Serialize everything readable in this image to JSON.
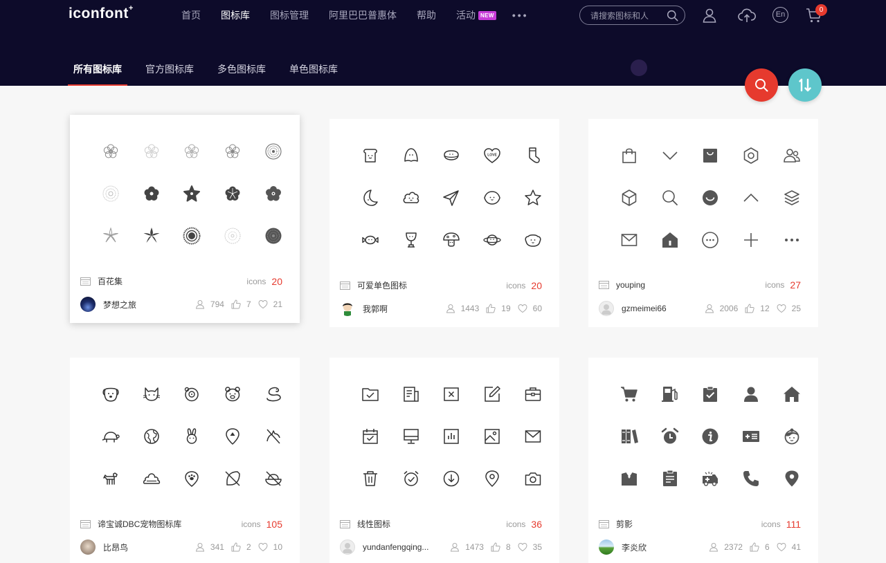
{
  "header": {
    "logo": "iconfont",
    "logo_mark": "+",
    "nav": [
      {
        "label": "首页",
        "active": false
      },
      {
        "label": "图标库",
        "active": true
      },
      {
        "label": "图标管理",
        "active": false
      },
      {
        "label": "阿里巴巴普惠体",
        "active": false
      },
      {
        "label": "帮助",
        "active": false
      },
      {
        "label": "活动",
        "active": false,
        "badge": "NEW"
      }
    ],
    "more": "•••",
    "search_placeholder": "请搜索图标和人",
    "lang": "En",
    "cart_count": "0",
    "subtabs": [
      {
        "label": "所有图标库",
        "active": true
      },
      {
        "label": "官方图标库",
        "active": false
      },
      {
        "label": "多色图标库",
        "active": false
      },
      {
        "label": "单色图标库",
        "active": false
      }
    ],
    "sort_label": "1↓"
  },
  "cards": [
    {
      "title": "百花集",
      "icons_label": "icons",
      "count": "20",
      "user": "梦想之旅",
      "views": "794",
      "likes": "7",
      "favs": "21"
    },
    {
      "title": "可爱单色图标",
      "icons_label": "icons",
      "count": "20",
      "user": "我郭啊",
      "views": "1443",
      "likes": "19",
      "favs": "60"
    },
    {
      "title": "youping",
      "icons_label": "icons",
      "count": "27",
      "user": "gzmeimei66",
      "views": "2006",
      "likes": "12",
      "favs": "25"
    },
    {
      "title": "谛宝诚DBC宠物图标库",
      "icons_label": "icons",
      "count": "105",
      "user": "比昂鸟",
      "views": "341",
      "likes": "2",
      "favs": "10"
    },
    {
      "title": "线性图标",
      "icons_label": "icons",
      "count": "36",
      "user": "yundanfengqing...",
      "views": "1473",
      "likes": "8",
      "favs": "35"
    },
    {
      "title": "剪影",
      "icons_label": "icons",
      "count": "111",
      "user": "李炎欣",
      "views": "2372",
      "likes": "6",
      "favs": "41"
    }
  ]
}
